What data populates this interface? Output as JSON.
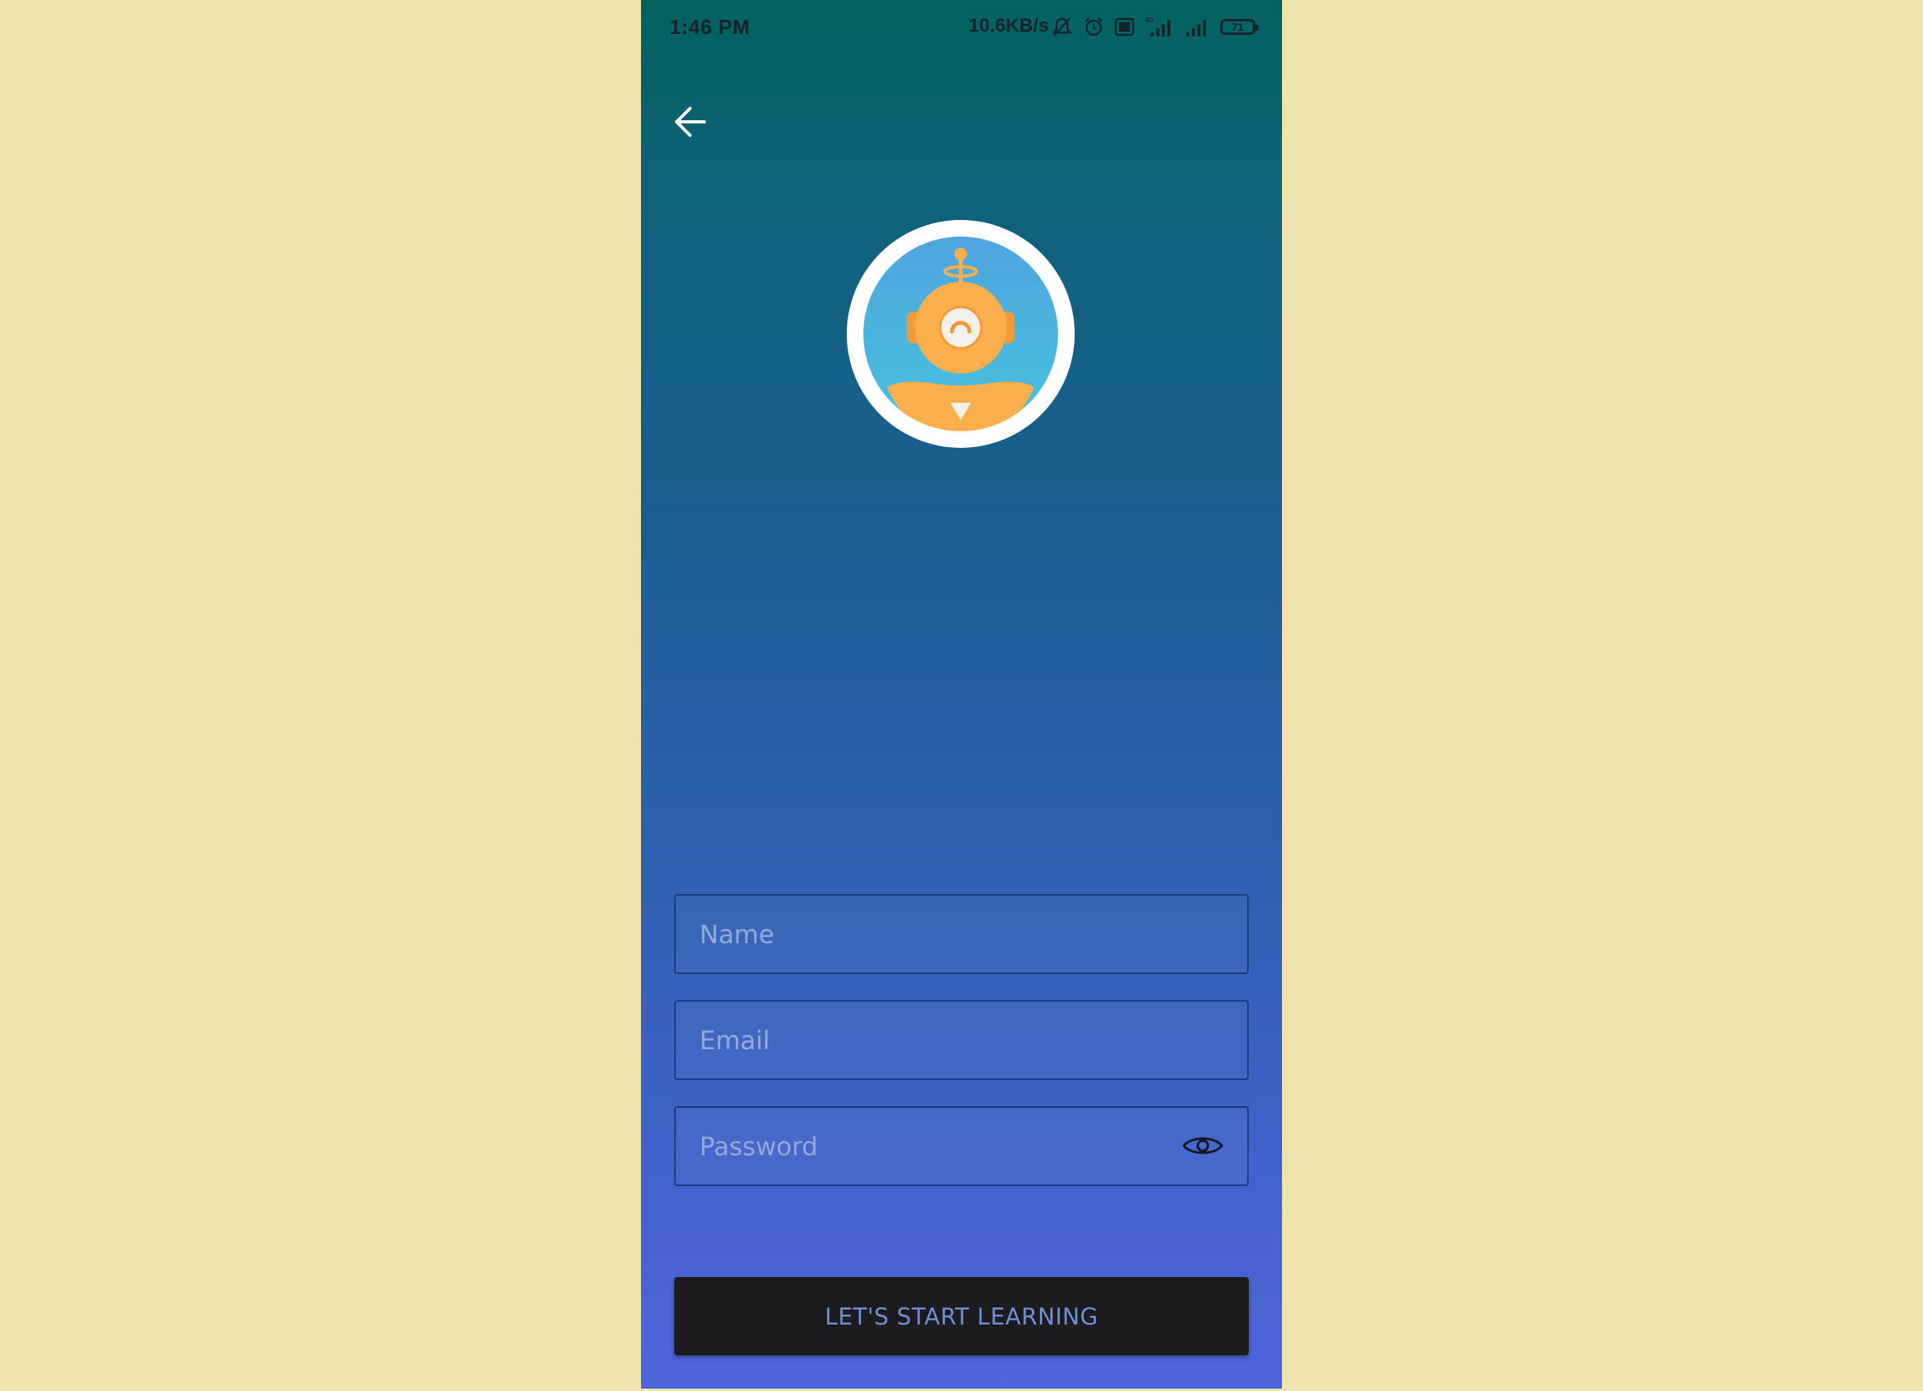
{
  "status_bar": {
    "time": "1:46 PM",
    "network_speed": "10.6KB/s",
    "battery_level": "71",
    "icons": [
      "mute-icon",
      "alarm-icon",
      "volte-icon",
      "signal-4g-icon",
      "signal-icon",
      "battery-icon"
    ]
  },
  "header": {
    "back_icon": "arrow-left-icon"
  },
  "avatar": {
    "icon": "robot-mascot",
    "colors": {
      "ring": "#ffffff",
      "background": "#4ea6df",
      "robot": "#fbae4c"
    }
  },
  "form": {
    "name_placeholder": "Name",
    "name_value": "",
    "email_placeholder": "Email",
    "email_value": "",
    "password_placeholder": "Password",
    "password_value": "",
    "password_toggle_icon": "eye-icon"
  },
  "cta": {
    "label": "LET'S START LEARNING"
  },
  "colors": {
    "page_background": "#efe3ad",
    "gradient_top": "#02625f",
    "gradient_bottom": "#5064dc",
    "button_background": "#1c1c1e",
    "button_text": "#6f8fd4"
  }
}
